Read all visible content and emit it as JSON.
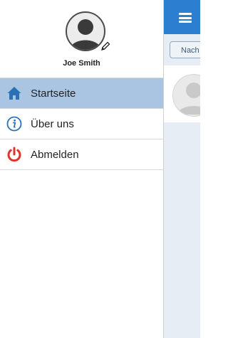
{
  "drawer": {
    "user": {
      "name": "Joe Smith",
      "avatar_icon": "user-avatar-icon",
      "edit_icon": "pencil-icon"
    },
    "menu": [
      {
        "label": "Startseite",
        "icon": "home-icon",
        "active": true
      },
      {
        "label": "Über uns",
        "icon": "info-icon",
        "active": false
      },
      {
        "label": "Abmelden",
        "icon": "power-icon",
        "active": false
      }
    ]
  },
  "main": {
    "menu_icon": "hamburger-icon",
    "button_label": "Nach",
    "card_avatar_icon": "user-avatar-icon"
  },
  "colors": {
    "accent": "#2c7fd0",
    "active_item": "#a9c5e2",
    "logout_red": "#e0332a",
    "icon_blue": "#2a72b8"
  }
}
